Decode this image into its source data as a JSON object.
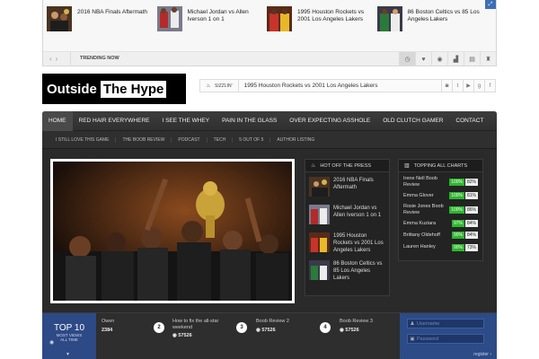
{
  "trending": {
    "label": "TRENDING NOW",
    "items": [
      {
        "title": "2016 NBA Finals Aftermath"
      },
      {
        "title": "Michael Jordan vs Allen Iverson 1 on 1"
      },
      {
        "title": "1995 Houston Rockets vs 2001 Los Angeles Lakers"
      },
      {
        "title": "86 Boston Celtics vs 85 Los Angeles Lakers"
      }
    ],
    "icons": [
      "clock-icon",
      "heart-icon",
      "eye-icon",
      "signal-icon",
      "chart-icon",
      "trophy-icon"
    ]
  },
  "header": {
    "logo_part1": "Outside",
    "logo_part2": "The Hype",
    "sizzlin_label": "SIZZLIN'",
    "sizzlin_text": "1995 Houston Rockets vs 2001 Los Angeles Lakers",
    "social": [
      "rss-icon",
      "twitter-icon",
      "youtube-icon",
      "googleplus-icon",
      "facebook-icon"
    ]
  },
  "nav": {
    "primary": [
      "HOME",
      "RED HAIR EVERYWHERE",
      "I SEE THE WHEY",
      "PAIN IN THE GLASS",
      "OVER EXPECTING ASSHOLE",
      "OLD CLUTCH GAMER",
      "CONTACT"
    ],
    "secondary": [
      "I STILL LOVE THIS GAME",
      "THE BOOB REVIEW",
      "PODCAST",
      "TECH",
      "5 OUT OF 5",
      "AUTHOR LISTING"
    ]
  },
  "hot": {
    "heading": "HOT OFF THE PRESS",
    "items": [
      {
        "title": "2016 NBA Finals Aftermath"
      },
      {
        "title": "Michael Jordan vs Allen Iverson 1 on 1"
      },
      {
        "title": "1995 Houston Rockets vs 2001 Los Angeles Lakers"
      },
      {
        "title": "86 Boston Celtics vs 85 Los Angeles Lakers"
      }
    ]
  },
  "charts": {
    "heading": "TOPPING ALL CHARTS",
    "rows": [
      {
        "name": "Irene Nell Boob Review",
        "a": "100%",
        "b": "82%"
      },
      {
        "name": "Emma Glover",
        "a": "100%",
        "b": "81%"
      },
      {
        "name": "Rosie Jones Boob Review",
        "a": "100%",
        "b": "86%"
      },
      {
        "name": "Emma Kuziara",
        "a": "97%",
        "b": "84%"
      },
      {
        "name": "Brittany Oldehoff",
        "a": "90%",
        "b": "84%"
      },
      {
        "name": "Lauren Hanley",
        "a": "90%",
        "b": "73%"
      }
    ]
  },
  "bottom": {
    "top10_title": "TOP 10",
    "top10_sub1": "MOST VIEWS",
    "top10_sub2": "ALL TIME",
    "items": [
      {
        "num": "",
        "title": "Owen",
        "views": "2384"
      },
      {
        "num": "2",
        "title": "How to fix the all-star weekend",
        "views": "57526"
      },
      {
        "num": "3",
        "title": "Boob Review 2",
        "views": "57526"
      },
      {
        "num": "4",
        "title": "Boob Review 3",
        "views": "57526"
      }
    ],
    "username_placeholder": "Username",
    "password_placeholder": "Password",
    "register": "register"
  }
}
